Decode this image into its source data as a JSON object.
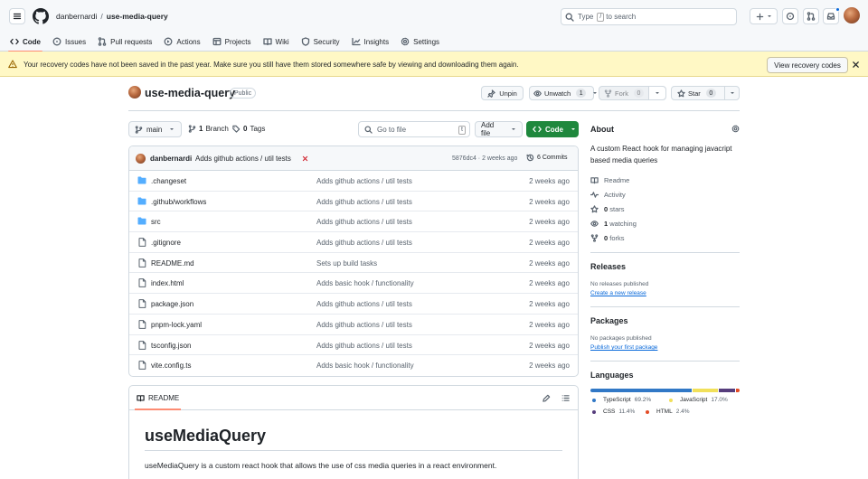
{
  "header": {
    "owner": "danbernardi",
    "separator": "/",
    "repo": "use-media-query",
    "search_prefix": "Type",
    "search_key": "/",
    "search_suffix": "to search"
  },
  "nav": {
    "tabs": [
      {
        "label": "Code",
        "icon": "code-icon"
      },
      {
        "label": "Issues",
        "icon": "issue-icon"
      },
      {
        "label": "Pull requests",
        "icon": "pull-request-icon"
      },
      {
        "label": "Actions",
        "icon": "play-icon"
      },
      {
        "label": "Projects",
        "icon": "table-icon"
      },
      {
        "label": "Wiki",
        "icon": "book-icon"
      },
      {
        "label": "Security",
        "icon": "shield-icon"
      },
      {
        "label": "Insights",
        "icon": "graph-icon"
      },
      {
        "label": "Settings",
        "icon": "gear-icon"
      }
    ],
    "active": "Code"
  },
  "banner": {
    "message": "Your recovery codes have not been saved in the past year. Make sure you still have them stored somewhere safe by viewing and downloading them again.",
    "button": "View recovery codes"
  },
  "repo": {
    "name": "use-media-query",
    "visibility": "Public",
    "unpin": "Unpin",
    "watch_label": "Unwatch",
    "watch_count": "1",
    "fork_label": "Fork",
    "fork_count": "0",
    "star_label": "Star",
    "star_count": "0"
  },
  "toolbar": {
    "branch": "main",
    "branch_count": "1",
    "branch_label": "Branch",
    "tag_count": "0",
    "tag_label": "Tags",
    "go_to_file": "Go to file",
    "go_to_file_key": "t",
    "add_file": "Add file",
    "code": "Code"
  },
  "commit": {
    "author": "danbernardi",
    "message": "Adds github actions / util tests",
    "hash_time": "5876dc4 · 2 weeks ago",
    "commits": "6 Commits"
  },
  "files": [
    {
      "type": "folder",
      "name": ".changeset",
      "message": "Adds github actions / util tests",
      "time": "2 weeks ago"
    },
    {
      "type": "folder",
      "name": ".github/workflows",
      "message": "Adds github actions / util tests",
      "time": "2 weeks ago"
    },
    {
      "type": "folder",
      "name": "src",
      "message": "Adds github actions / util tests",
      "time": "2 weeks ago"
    },
    {
      "type": "file",
      "name": ".gitignore",
      "message": "Adds github actions / util tests",
      "time": "2 weeks ago"
    },
    {
      "type": "file",
      "name": "README.md",
      "message": "Sets up build tasks",
      "time": "2 weeks ago"
    },
    {
      "type": "file",
      "name": "index.html",
      "message": "Adds basic hook / functionality",
      "time": "2 weeks ago"
    },
    {
      "type": "file",
      "name": "package.json",
      "message": "Adds github actions / util tests",
      "time": "2 weeks ago"
    },
    {
      "type": "file",
      "name": "pnpm-lock.yaml",
      "message": "Adds github actions / util tests",
      "time": "2 weeks ago"
    },
    {
      "type": "file",
      "name": "tsconfig.json",
      "message": "Adds github actions / util tests",
      "time": "2 weeks ago"
    },
    {
      "type": "file",
      "name": "vite.config.ts",
      "message": "Adds basic hook / functionality",
      "time": "2 weeks ago"
    }
  ],
  "readme": {
    "tab": "README",
    "heading": "useMediaQuery",
    "paragraph": "useMediaQuery is a custom react hook that allows the use of css media queries in a react environment."
  },
  "about": {
    "title": "About",
    "description": "A custom React hook for managing javacript based media queries",
    "readme": "Readme",
    "activity": "Activity",
    "stars_count": "0",
    "stars_label": "stars",
    "watching_count": "1",
    "watching_label": "watching",
    "forks_count": "0",
    "forks_label": "forks"
  },
  "releases": {
    "title": "Releases",
    "empty": "No releases published",
    "link": "Create a new release"
  },
  "packages": {
    "title": "Packages",
    "empty": "No packages published",
    "link": "Publish your first package"
  },
  "languages": {
    "title": "Languages",
    "items": [
      {
        "name": "TypeScript",
        "percent": "69.2%",
        "value": 69.2,
        "color": "#3178c6"
      },
      {
        "name": "JavaScript",
        "percent": "17.0%",
        "value": 17.0,
        "color": "#f1e05a"
      },
      {
        "name": "CSS",
        "percent": "11.4%",
        "value": 11.4,
        "color": "#563d7c"
      },
      {
        "name": "HTML",
        "percent": "2.4%",
        "value": 2.4,
        "color": "#e34c26"
      }
    ]
  }
}
